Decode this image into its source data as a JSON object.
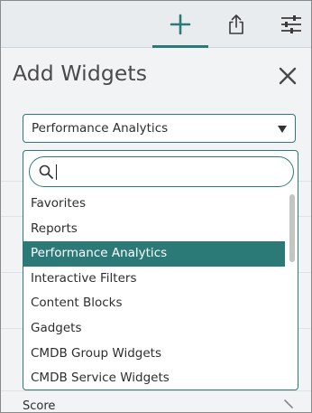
{
  "toolbar": {
    "add_icon": "plus-icon",
    "share_icon": "share-icon",
    "settings_icon": "sliders-icon",
    "accent_color": "#2b7a78"
  },
  "panel": {
    "title": "Add Widgets",
    "close_icon": "close-icon"
  },
  "select": {
    "value": "Performance Analytics"
  },
  "dropdown": {
    "search_value": "",
    "items": [
      "Favorites",
      "Reports",
      "Performance Analytics",
      "Interactive Filters",
      "Content Blocks",
      "Gadgets",
      "CMDB Group Widgets",
      "CMDB Service Widgets"
    ],
    "selected": "Performance Analytics"
  },
  "background": {
    "peek_label": "Score"
  }
}
